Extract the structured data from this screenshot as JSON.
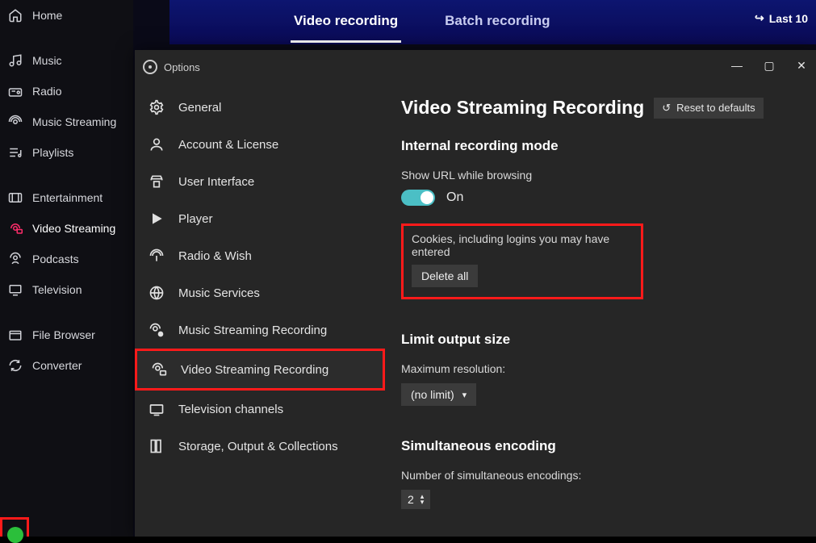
{
  "header": {
    "tabs": [
      {
        "label": "Video recording",
        "active": true
      },
      {
        "label": "Batch recording",
        "active": false
      }
    ],
    "last_label": "Last 10"
  },
  "sidebar": {
    "items": [
      {
        "label": "Home",
        "icon": "home-icon"
      },
      {
        "label": "Music",
        "icon": "music-icon"
      },
      {
        "label": "Radio",
        "icon": "radio-icon"
      },
      {
        "label": "Music Streaming",
        "icon": "music-streaming-icon"
      },
      {
        "label": "Playlists",
        "icon": "playlists-icon"
      },
      {
        "label": "Entertainment",
        "icon": "entertainment-icon"
      },
      {
        "label": "Video Streaming",
        "icon": "video-streaming-icon",
        "active": true
      },
      {
        "label": "Podcasts",
        "icon": "podcasts-icon"
      },
      {
        "label": "Television",
        "icon": "television-icon"
      },
      {
        "label": "File Browser",
        "icon": "file-browser-icon"
      },
      {
        "label": "Converter",
        "icon": "converter-icon"
      }
    ]
  },
  "settings": {
    "window_title": "Options",
    "nav": [
      {
        "label": "General",
        "icon": "gear-icon"
      },
      {
        "label": "Account & License",
        "icon": "account-icon"
      },
      {
        "label": "User Interface",
        "icon": "ui-icon"
      },
      {
        "label": "Player",
        "icon": "player-icon"
      },
      {
        "label": "Radio & Wish",
        "icon": "radio-wish-icon"
      },
      {
        "label": "Music Services",
        "icon": "music-services-icon"
      },
      {
        "label": "Music Streaming Recording",
        "icon": "music-rec-icon"
      },
      {
        "label": "Video Streaming Recording",
        "icon": "video-rec-icon",
        "selected": true
      },
      {
        "label": "Television channels",
        "icon": "tv-channels-icon"
      },
      {
        "label": "Storage, Output & Collections",
        "icon": "storage-icon"
      }
    ],
    "content": {
      "title": "Video Streaming Recording",
      "reset_label": "Reset to defaults",
      "section_internal": "Internal recording mode",
      "show_url_label": "Show URL while browsing",
      "show_url_state": "On",
      "cookies_label": "Cookies, including logins you may have entered",
      "delete_all_label": "Delete all",
      "section_limit": "Limit output size",
      "max_res_label": "Maximum resolution:",
      "max_res_value": "(no limit)",
      "section_simul": "Simultaneous encoding",
      "simul_label": "Number of simultaneous encodings:",
      "simul_value": "2"
    }
  }
}
